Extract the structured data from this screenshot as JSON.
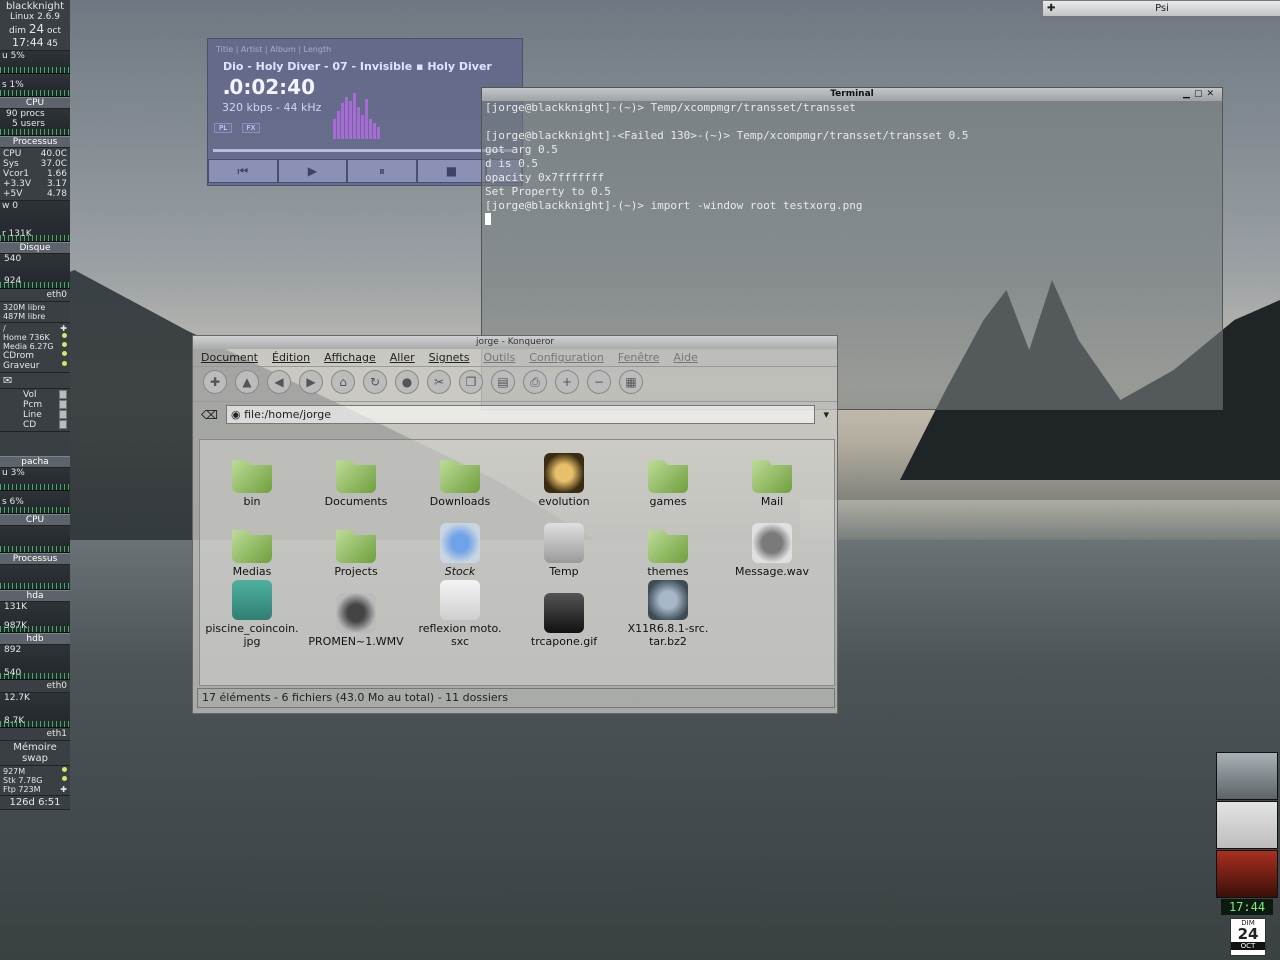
{
  "gkrellm": {
    "host": "blackknight",
    "kernel": "Linux 2.6.9",
    "date_day": "dim",
    "date_num": "24",
    "date_month": "oct",
    "time": "17:44",
    "seconds": "45",
    "cpu_user": "u 5%",
    "cpu_sys": "s 1%",
    "cpu_label": "CPU",
    "procs": "90 procs",
    "users": "5 users",
    "processus": "Processus",
    "temps": [
      [
        "CPU",
        "40.0C"
      ],
      [
        "Sys",
        "37.0C"
      ]
    ],
    "volts": [
      [
        "Vcor1",
        "1.66"
      ],
      [
        "+3.3V",
        "3.17"
      ],
      [
        "+5V",
        "4.78"
      ]
    ],
    "w_label": "w 0",
    "r_label": "r 131K",
    "disk_label": "Disque",
    "disk_vals": [
      "540",
      "924"
    ],
    "eth0": "eth0",
    "free1": "320M libre",
    "free2": "487M libre",
    "root": "/",
    "mounts": [
      [
        "Home 736K"
      ],
      [
        "Media 6.27G"
      ],
      [
        "CDrom"
      ],
      [
        "Graveur"
      ]
    ],
    "mixer": [
      "Vol",
      "Pcm",
      "Line",
      "CD"
    ],
    "host2": "pacha",
    "p_u": "u 3%",
    "p_s": "s 6%",
    "p_cpu": "CPU",
    "p_proc": "Processus",
    "hda": "hda",
    "hda_v": "131K",
    "hda_v2": "987K",
    "hdb": "hdb",
    "hdb_v": "892",
    "hdb_v2": "540",
    "p_eth0": "eth0",
    "eth0_v": "12.7K",
    "eth0_v2": "8.7K",
    "eth1": "eth1",
    "mem": "Mémoire",
    "swap": "swap",
    "m1": "927M",
    "m2": "Stk 7.78G",
    "m3": "Ftp 723M",
    "uptime": "126d  6:51"
  },
  "player": {
    "cols": "Title | Artist | Album | Length",
    "song": "Dio - Holy Diver - 07 - Invisible  ▪  Holy Diver",
    "time": "0:02:40",
    "rate": "320 kbps - 44 kHz",
    "pl": "PL",
    "fx": "FX"
  },
  "terminal": {
    "title": "Terminal",
    "lines": [
      "[jorge@blackknight]-(~)> Temp/xcompmgr/transset/transset",
      "",
      "[jorge@blackknight]-<Failed 130>-(~)> Temp/xcompmgr/transset/transset 0.5",
      "got arg 0.5",
      "d is 0.5",
      "opacity 0x7fffffff",
      "Set Property to 0.5",
      "[jorge@blackknight]-(~)> import -window root testxorg.png"
    ]
  },
  "konqueror": {
    "title": "jorge - Konqueror",
    "menu": [
      "Document",
      "Édition",
      "Affichage",
      "Aller",
      "Signets",
      "Outils",
      "Configuration",
      "Fenêtre",
      "Aide"
    ],
    "location": "file:/home/jorge",
    "files": [
      {
        "name": "bin",
        "kind": "folder"
      },
      {
        "name": "Documents",
        "kind": "folder"
      },
      {
        "name": "Downloads",
        "kind": "folder"
      },
      {
        "name": "evolution",
        "kind": "app"
      },
      {
        "name": "games",
        "kind": "folder"
      },
      {
        "name": "Mail",
        "kind": "folder"
      },
      {
        "name": "Medias",
        "kind": "folder"
      },
      {
        "name": "Projects",
        "kind": "folder"
      },
      {
        "name": "Stock",
        "kind": "link"
      },
      {
        "name": "Temp",
        "kind": "trash"
      },
      {
        "name": "themes",
        "kind": "folder"
      },
      {
        "name": "Message.wav",
        "kind": "sound"
      },
      {
        "name": "piscine_coincoin.\njpg",
        "kind": "image"
      },
      {
        "name": "PROMEN~1.WMV",
        "kind": "video"
      },
      {
        "name": "reflexion moto.\nsxc",
        "kind": "doc"
      },
      {
        "name": "trcapone.gif",
        "kind": "image2"
      },
      {
        "name": "X11R6.8.1-src.\ntar.bz2",
        "kind": "archive"
      }
    ],
    "status": "17 éléments - 6 fichiers (43.0 Mo au total) - 11 dossiers"
  },
  "psi": {
    "title": "Psi"
  },
  "clock": {
    "time": "17:44",
    "day": "DIM",
    "num": "24",
    "month": "OCT"
  }
}
